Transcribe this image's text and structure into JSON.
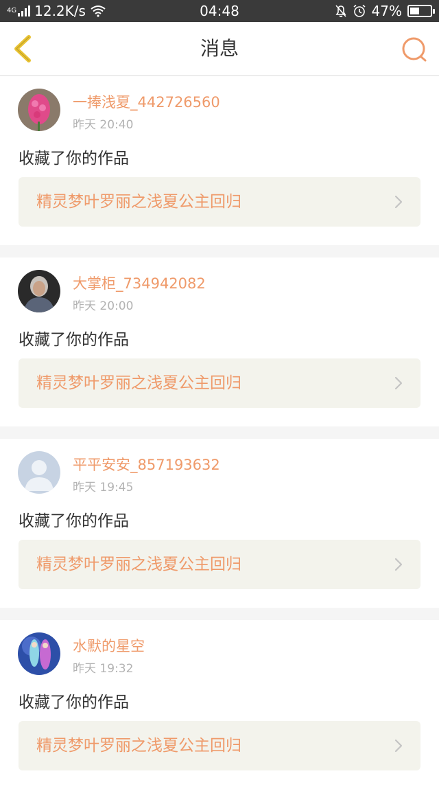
{
  "status_bar": {
    "network_type": "4G",
    "speed": "12.2K/s",
    "time": "04:48",
    "battery": "47%",
    "battery_level": 0.47
  },
  "nav": {
    "title": "消息"
  },
  "colors": {
    "accent": "#ef9a6a",
    "back_icon": "#e8c232"
  },
  "messages": [
    {
      "avatar": "flower-avatar",
      "username": "一捧浅夏_442726560",
      "time": "昨天 20:40",
      "action": "收藏了你的作品",
      "work_title": "精灵梦叶罗丽之浅夏公主回归"
    },
    {
      "avatar": "elderly-woman-avatar",
      "username": "大掌柜_734942082",
      "time": "昨天 20:00",
      "action": "收藏了你的作品",
      "work_title": "精灵梦叶罗丽之浅夏公主回归"
    },
    {
      "avatar": "default-user-avatar",
      "username": "平平安安_857193632",
      "time": "昨天 19:45",
      "action": "收藏了你的作品",
      "work_title": "精灵梦叶罗丽之浅夏公主回归"
    },
    {
      "avatar": "anime-avatar",
      "username": "水默的星空",
      "time": "昨天 19:32",
      "action": "收藏了你的作品",
      "work_title": "精灵梦叶罗丽之浅夏公主回归"
    }
  ]
}
